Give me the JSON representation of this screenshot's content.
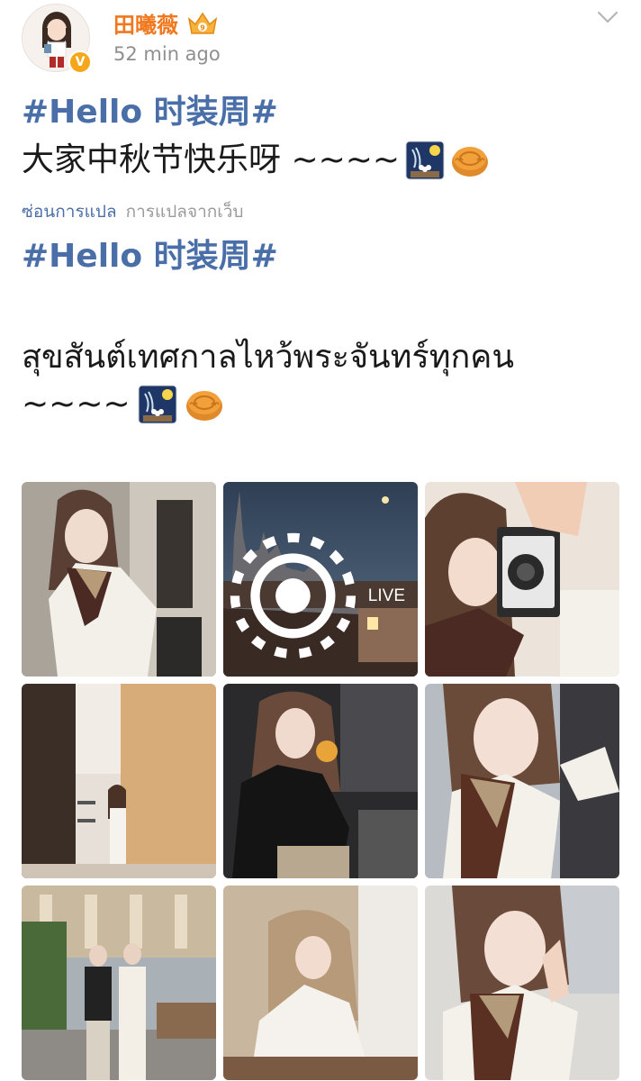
{
  "post": {
    "author": "田曦薇",
    "time": "52 min ago",
    "hashtag": "#Hello 时装周#",
    "text": "大家中秋节快乐呀 ~~~~",
    "translate_hide": "ซ่อนการแปล",
    "translate_source": "การแปลจากเว็บ",
    "hashtag_translated": "#Hello 时装周#",
    "text_translated_line1": "สุขสันต์เทศกาลไหว้พระจันทร์ทุกคน",
    "text_translated_line2": "~~~~"
  },
  "icons": {
    "crown": "vip-crown-icon",
    "verified": "verified-badge-icon",
    "chevron": "chevron-down-icon",
    "emoji_moon": "moon-viewing-emoji",
    "emoji_mooncake": "mooncake-emoji",
    "live": "live-photo-icon"
  },
  "colors": {
    "author": "#f0781e",
    "hashtag": "#4a6fa8",
    "meta": "#8f8f8f"
  },
  "photos": [
    {
      "id": "photo-1"
    },
    {
      "id": "photo-2",
      "badge": "LIVE"
    },
    {
      "id": "photo-3"
    },
    {
      "id": "photo-4"
    },
    {
      "id": "photo-5"
    },
    {
      "id": "photo-6"
    },
    {
      "id": "photo-7"
    },
    {
      "id": "photo-8"
    },
    {
      "id": "photo-9"
    }
  ]
}
